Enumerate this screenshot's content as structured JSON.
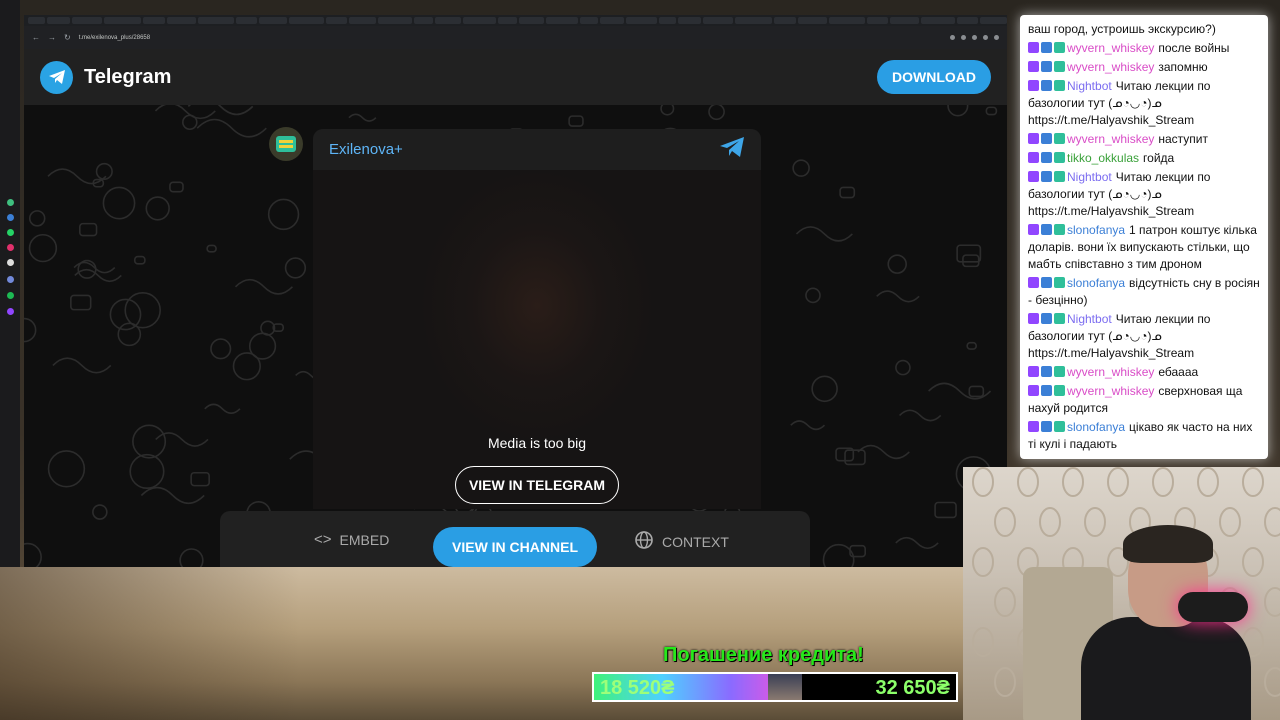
{
  "browser": {
    "url": "t.me/exilenova_plus/28658",
    "back_icon": "back-arrow-icon",
    "forward_icon": "forward-arrow-icon",
    "reload_icon": "reload-icon"
  },
  "telegram": {
    "brand": "Telegram",
    "download_label": "DOWNLOAD",
    "post": {
      "channel_name": "Exilenova+",
      "media_message": "Media is too big",
      "view_in_telegram_label": "VIEW IN TELEGRAM"
    },
    "footer": {
      "embed_label": "EMBED",
      "view_in_channel_label": "VIEW IN CHANNEL",
      "context_label": "CONTEXT"
    },
    "accent_color": "#2a9ee4"
  },
  "chat": {
    "messages": [
      {
        "user": "",
        "text": "ваш город, устроишь экскурсию?)",
        "color": "#111111"
      },
      {
        "user": "wyvern_whiskey",
        "text": "после войны",
        "color": "#d94cc7"
      },
      {
        "user": "wyvern_whiskey",
        "text": "запомню",
        "color": "#d94cc7"
      },
      {
        "user": "Nightbot",
        "text": "Читаю лекции по базологии тут (ᓄ◔◡◔)ᓄ https://t.me/Halyavshik_Stream",
        "color": "#7b6cf0"
      },
      {
        "user": "wyvern_whiskey",
        "text": "наступит",
        "color": "#d94cc7"
      },
      {
        "user": "tikko_okkulas",
        "text": "гойда",
        "color": "#3aa13a"
      },
      {
        "user": "Nightbot",
        "text": "Читаю лекции по базологии тут (ᓄ◔◡◔)ᓄ https://t.me/Halyavshik_Stream",
        "color": "#7b6cf0"
      },
      {
        "user": "slonofanya",
        "text": "1 патрон коштує кілька доларів. вони їх випускають стільки, що мабть співставно з тим дроном",
        "color": "#3b7fd6"
      },
      {
        "user": "slonofanya",
        "text": "відсутність сну в росіян - безцінно)",
        "color": "#3b7fd6"
      },
      {
        "user": "Nightbot",
        "text": "Читаю лекции по базологии тут (ᓄ◔◡◔)ᓄ https://t.me/Halyavshik_Stream",
        "color": "#7b6cf0"
      },
      {
        "user": "wyvern_whiskey",
        "text": "ебаааа",
        "color": "#d94cc7"
      },
      {
        "user": "wyvern_whiskey",
        "text": "сверхновая ща нахуй родится",
        "color": "#d94cc7"
      },
      {
        "user": "slonofanya",
        "text": "цікаво як часто на них ті кулі і падають",
        "color": "#3b7fd6"
      }
    ]
  },
  "overlay": {
    "goal_title": "Погашение кредита!",
    "current_amount": "18 520₴",
    "goal_amount": "32 650₴",
    "progress_fraction": 0.567,
    "title_color": "#27e81a"
  }
}
